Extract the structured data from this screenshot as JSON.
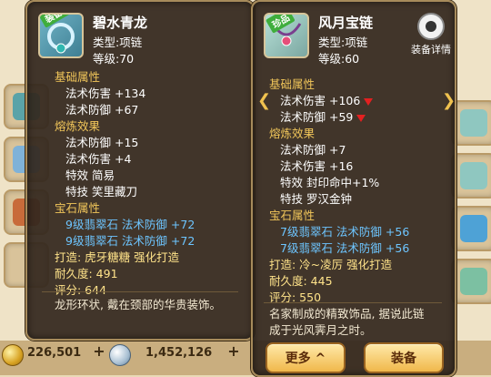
{
  "left_item": {
    "ribbon": "装备中",
    "name": "碧水青龙",
    "type_line": "类型:项链",
    "level_line": "等级:70",
    "sections": {
      "base_title": "基础属性",
      "base": [
        "法术伤害 +134",
        "法术防御 +67"
      ],
      "refine_title": "熔炼效果",
      "refine": [
        "法术防御 +15",
        "法术伤害 +4"
      ],
      "effect_line": "特效  简易",
      "skill_line": "特技  笑里藏刀",
      "gem_title": "宝石属性",
      "gems": [
        "9级翡翠石 法术防御 +72",
        "9级翡翠石 法术防御 +72"
      ],
      "maker": "打造: 虎牙糖糖  强化打造",
      "durability": "耐久度: 491",
      "score": "评分: 644"
    },
    "description": "龙形环状, 戴在颈部的华贵装饰。"
  },
  "right_item": {
    "ribbon": "珍品",
    "name": "风月宝链",
    "type_line": "类型:项链",
    "level_line": "等级:60",
    "detail_label": "装备详情",
    "sections": {
      "base_title": "基础属性",
      "base": [
        "法术伤害 +106",
        "法术防御 +59"
      ],
      "refine_title": "熔炼效果",
      "refine": [
        "法术防御 +7",
        "法术伤害 +16"
      ],
      "effect_line": "特效  封印命中+1%",
      "skill_line": "特技  罗汉金钟",
      "gem_title": "宝石属性",
      "gems": [
        "7级翡翠石 法术防御 +56",
        "7级翡翠石 法术防御 +56"
      ],
      "maker": "打造: 冷~凌厉  强化打造",
      "durability": "耐久度: 445",
      "score": "评分: 550"
    },
    "description_1": "名家制成的精致饰品, 据说此链",
    "description_2": "成于光风霁月之时。",
    "more_button": "更多 ^",
    "equip_button": "装备"
  },
  "currency": {
    "gold": "226,501",
    "silver": "1,452,126"
  },
  "colors": {
    "section": "#f1c65a",
    "gem": "#6dc5ff",
    "maker": "#ffe38a"
  }
}
